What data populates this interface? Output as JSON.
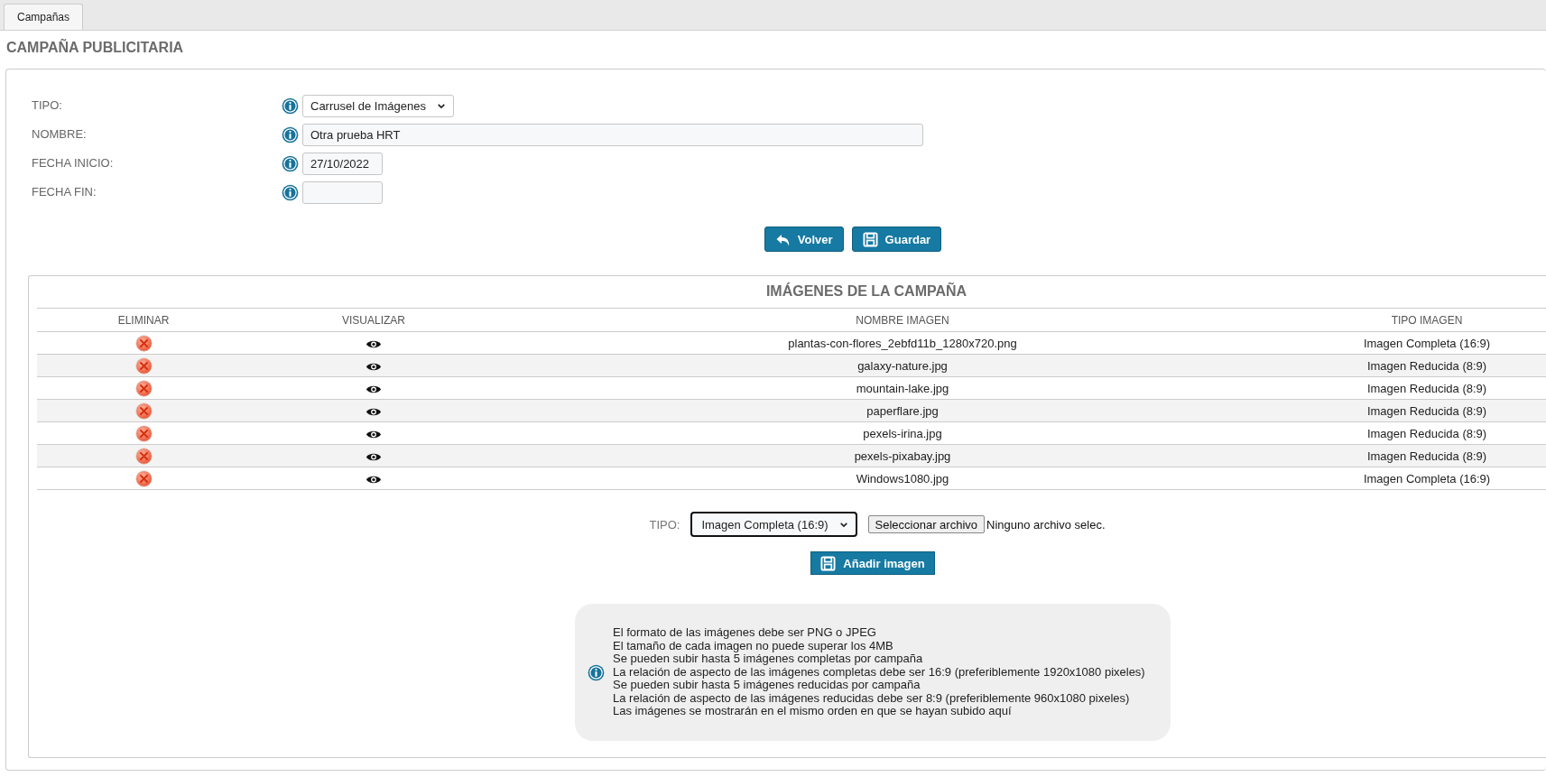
{
  "tabs": [
    {
      "label": "Campañas",
      "selected": true
    }
  ],
  "title": "CAMPAÑA PUBLICITARIA",
  "form": {
    "fields": [
      {
        "label": "TIPO:",
        "kind": "select",
        "value": "Carrusel de Imágenes"
      },
      {
        "label": "NOMBRE:",
        "kind": "text",
        "value": "Otra prueba HRT"
      },
      {
        "label": "FECHA INICIO:",
        "kind": "date",
        "value": "27/10/2022"
      },
      {
        "label": "FECHA FIN:",
        "kind": "date"
      }
    ]
  },
  "actions": [
    {
      "label": "Volver",
      "kind": "back"
    },
    {
      "label": "Guardar",
      "kind": "save"
    }
  ],
  "images": {
    "title": "IMÁGENES DE LA CAMPAÑA",
    "columns": [
      "ELIMINAR",
      "VISUALIZAR",
      "NOMBRE IMAGEN",
      "TIPO IMAGEN"
    ],
    "rows": [
      {
        "name": "plantas-con-flores_2ebfd11b_1280x720.png",
        "type": "Imagen Completa (16:9)"
      },
      {
        "name": "galaxy-nature.jpg",
        "type": "Imagen Reducida (8:9)"
      },
      {
        "name": "mountain-lake.jpg",
        "type": "Imagen Reducida (8:9)"
      },
      {
        "name": "paperflare.jpg",
        "type": "Imagen Reducida (8:9)"
      },
      {
        "name": "pexels-irina.jpg",
        "type": "Imagen Reducida (8:9)"
      },
      {
        "name": "pexels-pixabay.jpg",
        "type": "Imagen Reducida (8:9)"
      },
      {
        "name": "Windows1080.jpg",
        "type": "Imagen Completa (16:9)"
      }
    ],
    "upload": {
      "label": "TIPO:",
      "type_value": "Imagen Completa (16:9)",
      "file_button": "Seleccionar archivo",
      "file_status": "Ninguno archivo selec.",
      "add_button": "Añadir imagen"
    },
    "notes": [
      "El formato de las imágenes debe ser PNG o JPEG",
      "El tamaño de cada imagen no puede superar los 4MB",
      "Se pueden subir hasta 5 imágenes completas por campaña",
      "La relación de aspecto de las imágenes completas debe ser 16:9 (preferiblemente 1920x1080 pixeles)",
      "Se pueden subir hasta 5 imágenes reducidas por campaña",
      "La relación de aspecto de las imágenes reducidas debe ser 8:9 (preferiblemente 960x1080 pixeles)",
      "Las imágenes se mostrarán en el mismo orden en que se hayan subido aquí"
    ]
  }
}
